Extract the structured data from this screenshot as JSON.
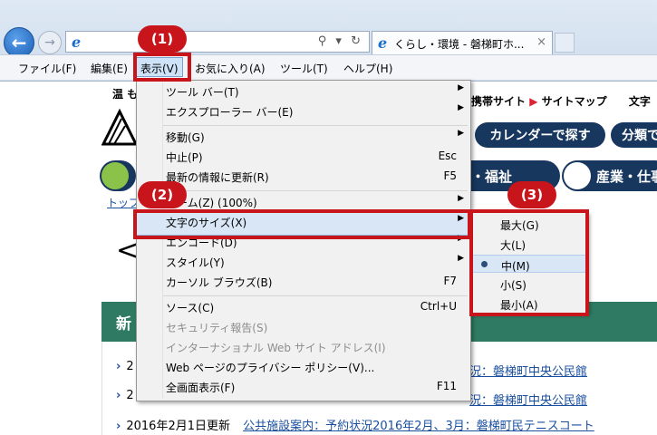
{
  "browser": {
    "tab_title": "くらし・環境 - 磐梯町ホ...",
    "tab_close": "×",
    "back": "←",
    "forward": "→",
    "address_tools": "⚲ ▾ ↻",
    "ie_glyph": "e"
  },
  "menubar": {
    "items": [
      "ファイル(F)",
      "編集(E)",
      "表示(V)",
      "お気に入り(A)",
      "ツール(T)",
      "ヘルプ(H)"
    ]
  },
  "page": {
    "logo_text": "温 も",
    "top_links": [
      "携帯サイト",
      "サイトマップ",
      "文字"
    ],
    "calendar_button": "カレンダーで探す",
    "bunrui_button": "分類で",
    "nav": [
      "・福祉",
      "産業・仕事"
    ],
    "breadcrumb": "トップ",
    "big_arrow": "<",
    "section_title": "新",
    "news": [
      {
        "date": "2",
        "link": "況：磐梯町中央公民館"
      },
      {
        "date": "2",
        "link": "況：磐梯町中央公民館"
      },
      {
        "date": "2016年2月1日更新",
        "link": "公共施設案内：予約状況2016年2月、3月：磐梯町民テニスコート"
      }
    ]
  },
  "view_menu": {
    "items": [
      {
        "label": "ツール バー(T)",
        "key": "",
        "submenu": true,
        "disabled": false
      },
      {
        "label": "エクスプローラー バー(E)",
        "key": "",
        "submenu": true,
        "disabled": false
      },
      {
        "label": "移動(G)",
        "key": "",
        "submenu": true,
        "disabled": false
      },
      {
        "label": "中止(P)",
        "key": "Esc",
        "submenu": false,
        "disabled": false
      },
      {
        "label": "最新の情報に更新(R)",
        "key": "F5",
        "submenu": false,
        "disabled": false
      },
      {
        "label": "ズーム(Z) (100%)",
        "key": "",
        "submenu": true,
        "disabled": false
      },
      {
        "label": "文字のサイズ(X)",
        "key": "",
        "submenu": true,
        "disabled": false
      },
      {
        "label": "エンコード(D)",
        "key": "",
        "submenu": true,
        "disabled": false
      },
      {
        "label": "スタイル(Y)",
        "key": "",
        "submenu": true,
        "disabled": false
      },
      {
        "label": "カーソル ブラウズ(B)",
        "key": "F7",
        "submenu": false,
        "disabled": false
      },
      {
        "label": "ソース(C)",
        "key": "Ctrl+U",
        "submenu": false,
        "disabled": false
      },
      {
        "label": "セキュリティ報告(S)",
        "key": "",
        "submenu": false,
        "disabled": true
      },
      {
        "label": "インターナショナル Web サイト アドレス(I)",
        "key": "",
        "submenu": false,
        "disabled": true
      },
      {
        "label": "Web ページのプライバシー ポリシー(V)...",
        "key": "",
        "submenu": false,
        "disabled": false
      },
      {
        "label": "全画面表示(F)",
        "key": "F11",
        "submenu": false,
        "disabled": false
      }
    ],
    "submenu_arrow": "▶"
  },
  "text_size_menu": {
    "items": [
      "最大(G)",
      "大(L)",
      "中(M)",
      "小(S)",
      "最小(A)"
    ],
    "selected": "中(M)"
  },
  "callouts": [
    "(1)",
    "(2)",
    "(3)"
  ],
  "colors": {
    "callout_red": "#c8151b",
    "nav_blue": "#17375e",
    "section_green": "#2f7a62"
  }
}
